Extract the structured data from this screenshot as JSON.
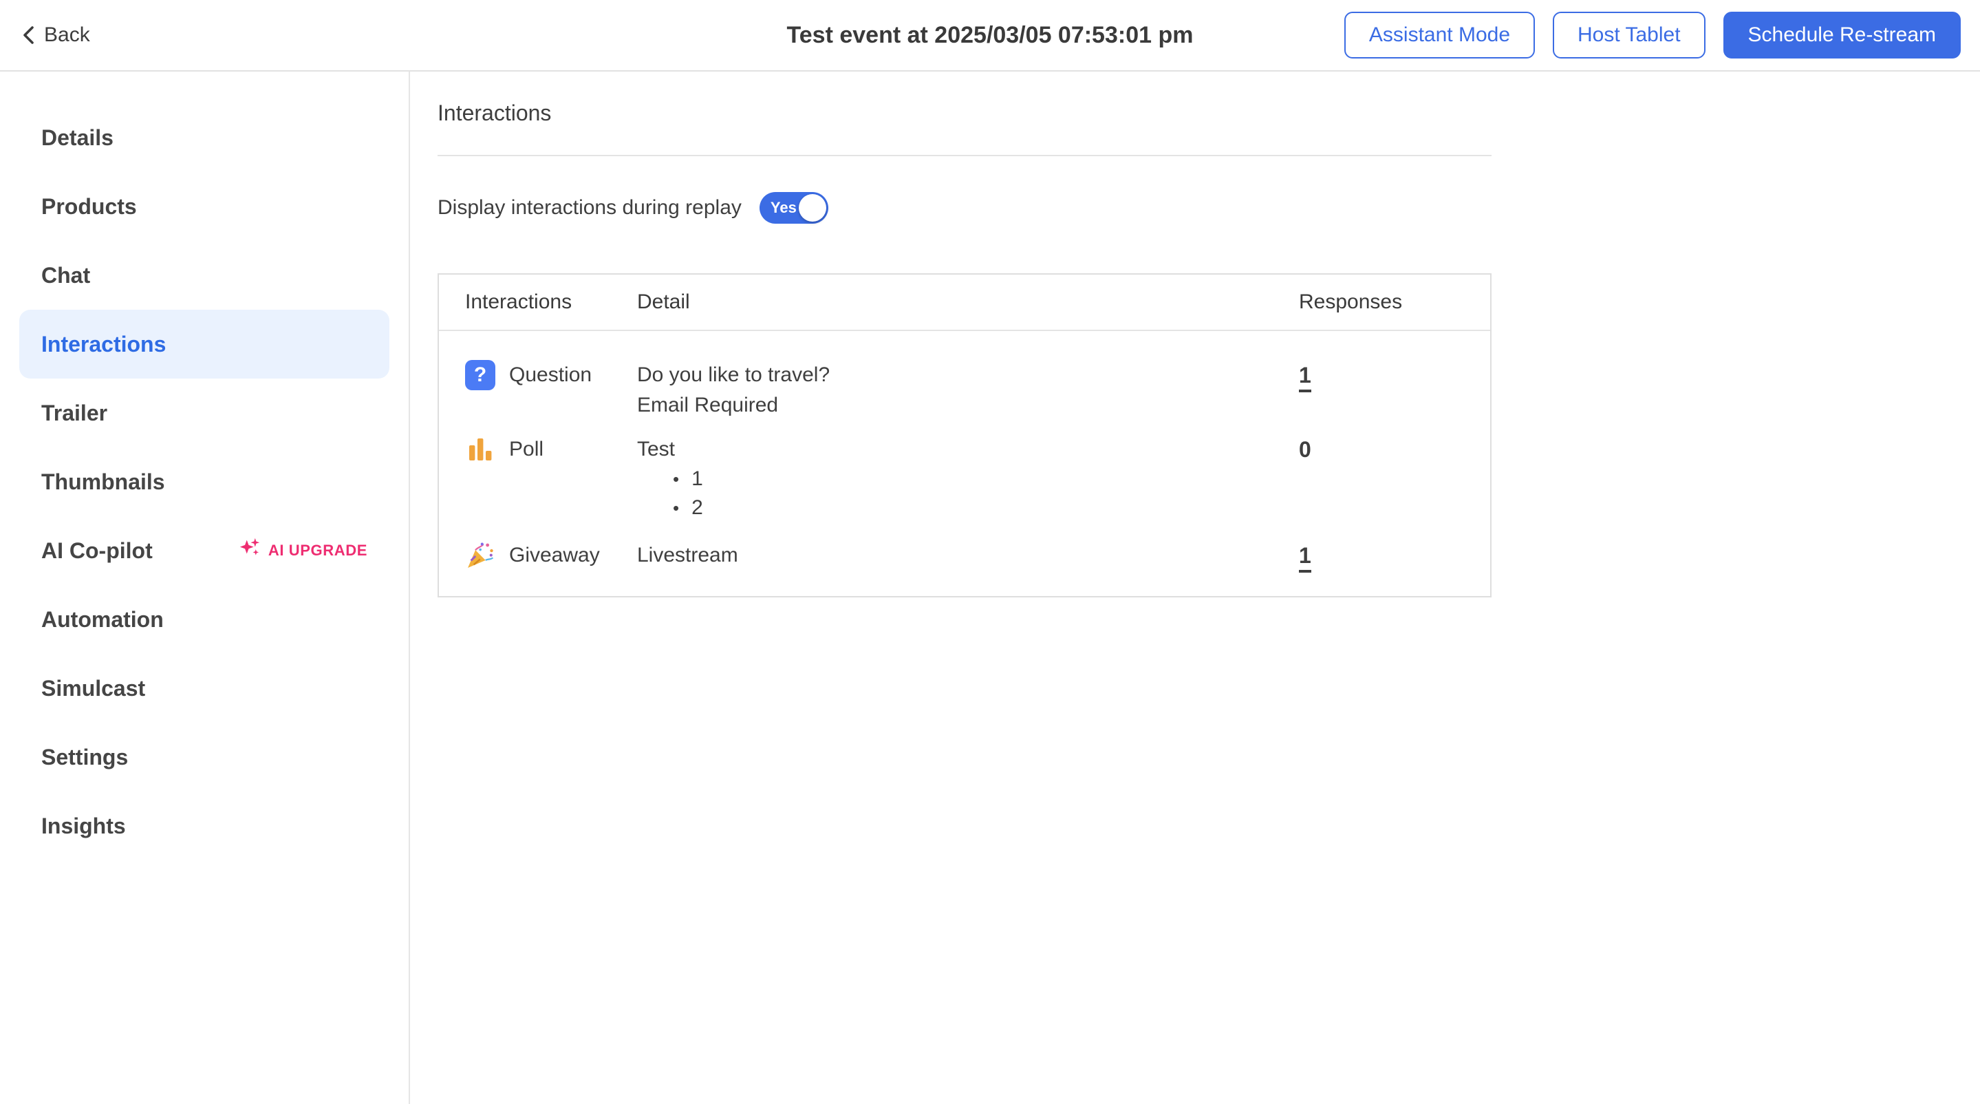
{
  "header": {
    "back_label": "Back",
    "title": "Test event at 2025/03/05 07:53:01 pm",
    "buttons": [
      {
        "label": "Assistant Mode",
        "variant": "outline"
      },
      {
        "label": "Host Tablet",
        "variant": "outline"
      },
      {
        "label": "Schedule Re-stream",
        "variant": "primary"
      }
    ]
  },
  "sidebar": {
    "items": [
      {
        "label": "Details"
      },
      {
        "label": "Products"
      },
      {
        "label": "Chat"
      },
      {
        "label": "Interactions",
        "selected": true
      },
      {
        "label": "Trailer"
      },
      {
        "label": "Thumbnails"
      },
      {
        "label": "AI Co-pilot",
        "badge": "AI UPGRADE"
      },
      {
        "label": "Automation"
      },
      {
        "label": "Simulcast"
      },
      {
        "label": "Settings"
      },
      {
        "label": "Insights"
      }
    ]
  },
  "main": {
    "section_title": "Interactions",
    "replay": {
      "label": "Display interactions during replay",
      "value": "Yes",
      "state": "on"
    },
    "table": {
      "columns": [
        "Interactions",
        "Detail",
        "Responses"
      ],
      "rows": [
        {
          "type": "Question",
          "icon": "question-icon",
          "icon_glyph": "?",
          "details": [
            "Do you like to travel?",
            "Email Required"
          ],
          "responses": "1",
          "responses_link": true
        },
        {
          "type": "Poll",
          "icon": "poll-icon",
          "details": [
            "Test"
          ],
          "bullets": [
            "1",
            "2"
          ],
          "responses": "0",
          "responses_link": false
        },
        {
          "type": "Giveaway",
          "icon": "giveaway-icon",
          "details": [
            "Livestream"
          ],
          "responses": "1",
          "responses_link": true
        }
      ]
    }
  },
  "colors": {
    "accent": "#3b6ce4",
    "accent_light": "#eaf2fe",
    "badge_pink": "#ee2d71",
    "poll_orange": "#f0a43c",
    "question_blue": "#4b7bf5",
    "text_dark": "#3f3f3f"
  }
}
